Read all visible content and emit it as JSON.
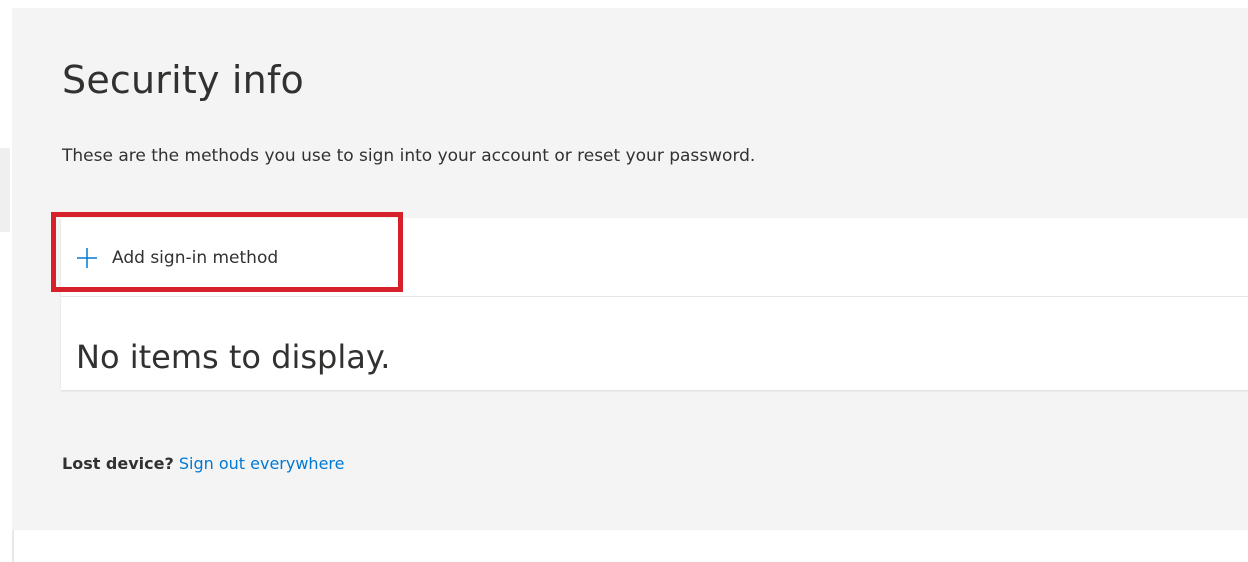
{
  "page": {
    "title": "Security info",
    "subtitle": "These are the methods you use to sign into your account or reset your password."
  },
  "methods": {
    "add_button_label": "Add sign-in method",
    "add_icon": "plus-icon",
    "empty_message": "No items to display."
  },
  "footer": {
    "lost_device_label": "Lost device?",
    "sign_out_link": "Sign out everywhere"
  },
  "colors": {
    "panel_background": "#f4f4f4",
    "card_background": "#ffffff",
    "text": "#323130",
    "link": "#0078d4",
    "icon_accent": "#0078d4",
    "highlight": "#d6202a"
  }
}
